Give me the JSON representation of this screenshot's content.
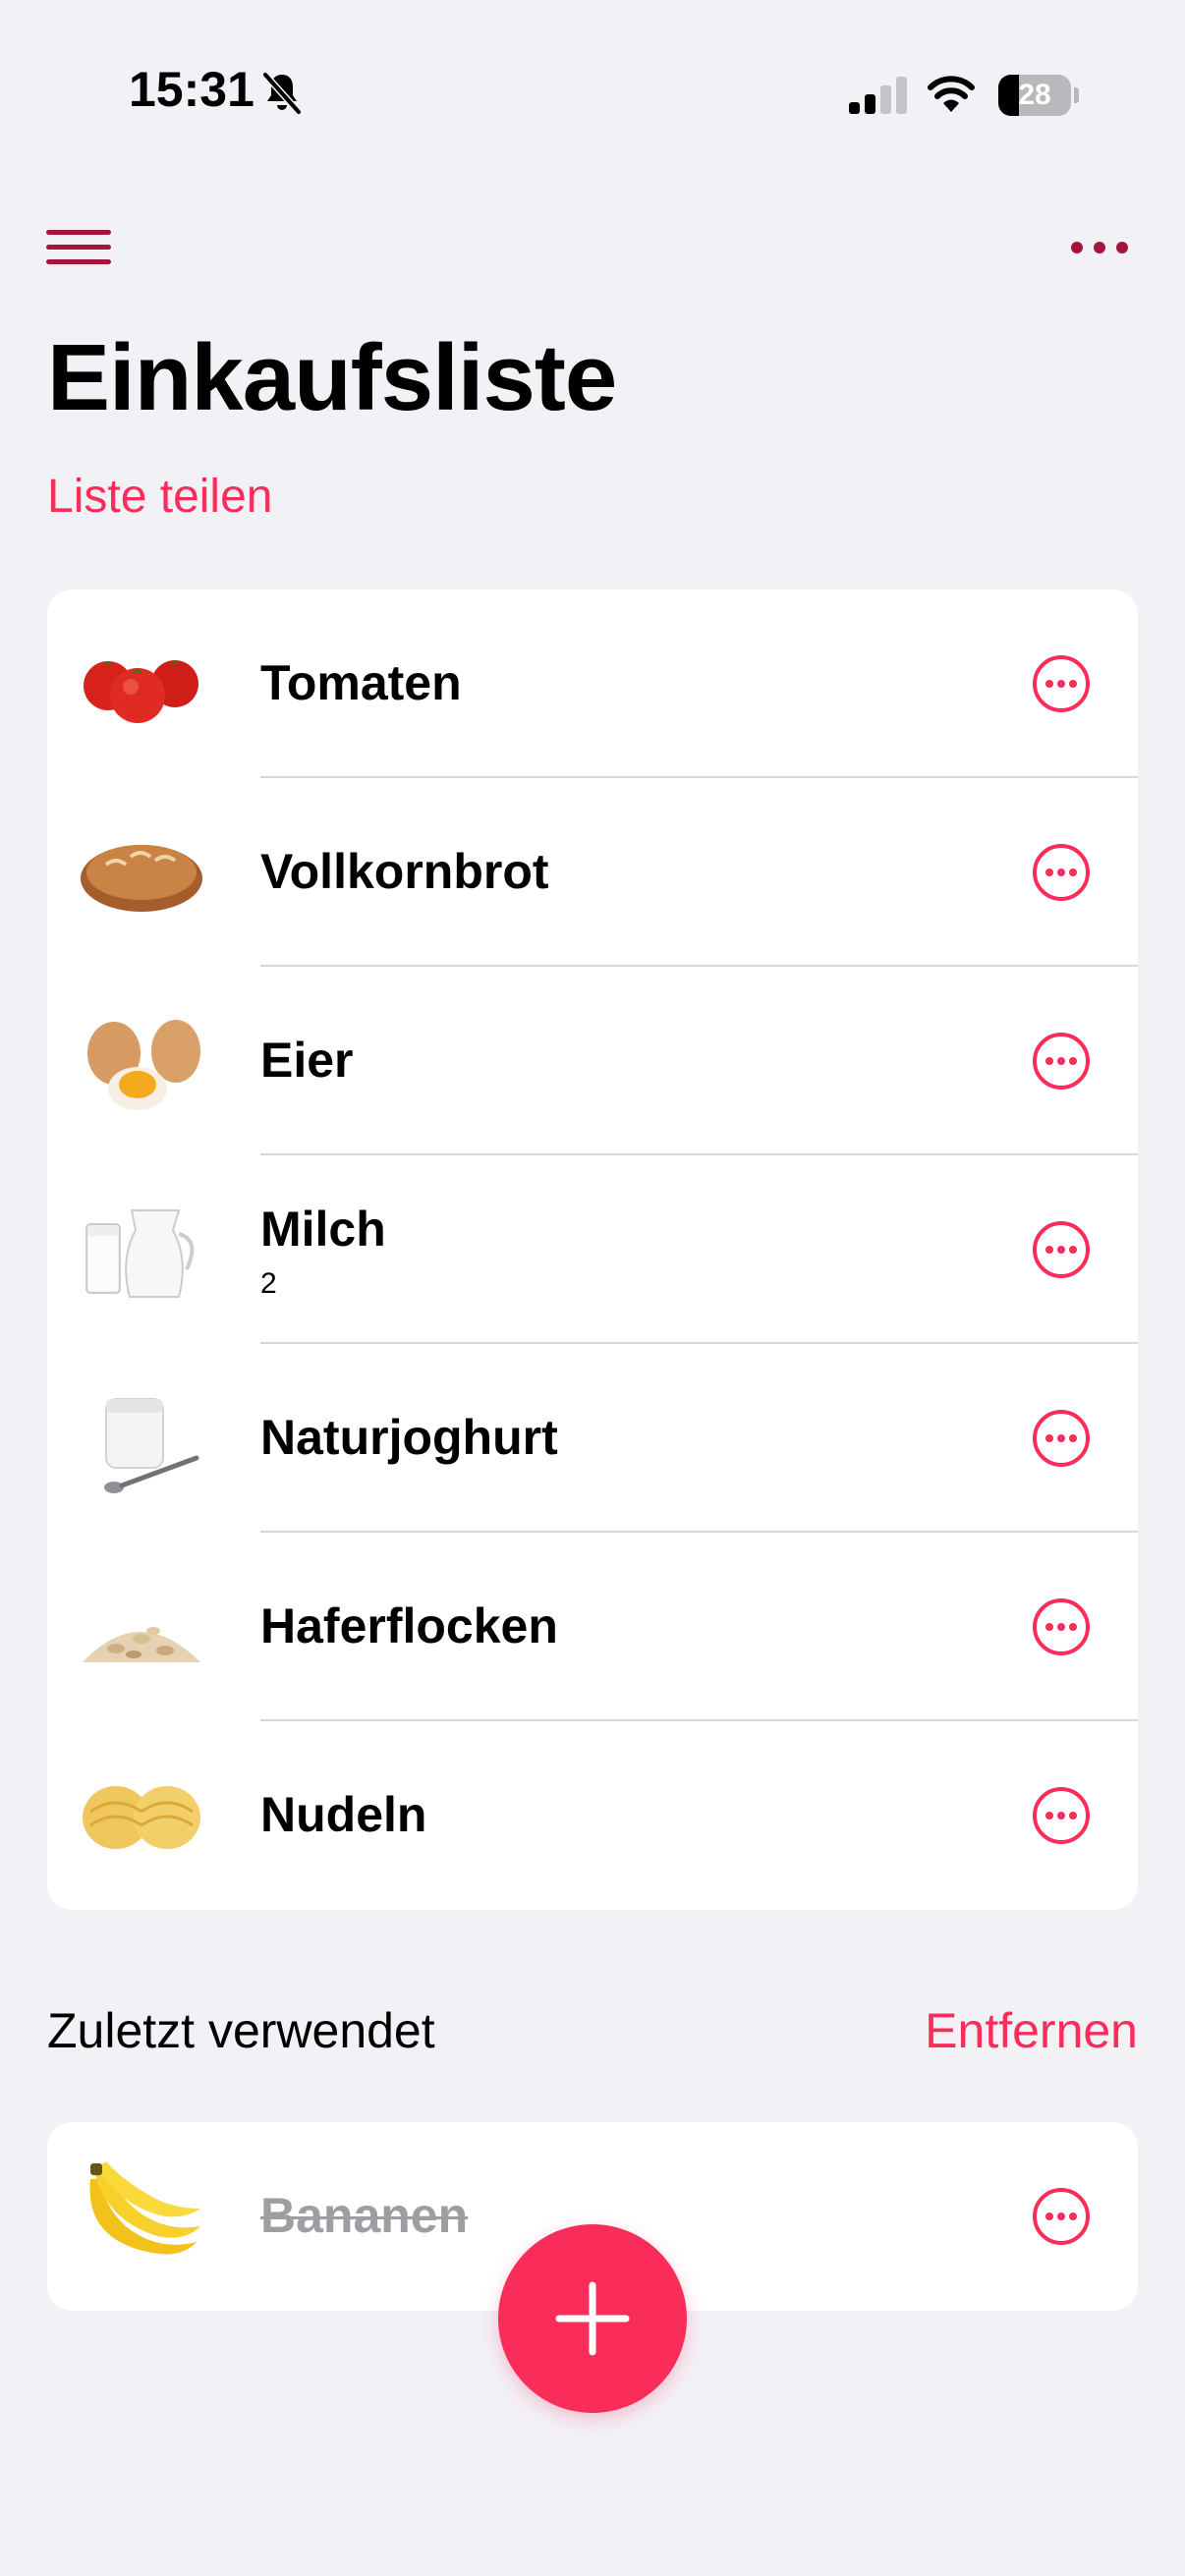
{
  "status_bar": {
    "time": "15:31",
    "battery": "28",
    "battery_level": 0.28,
    "icons": [
      "bell-slash-icon",
      "cellular-signal-icon",
      "wifi-icon",
      "battery-icon"
    ]
  },
  "nav": {
    "left_icon": "hamburger-menu-icon",
    "right_icon": "ellipsis-icon"
  },
  "header": {
    "title": "Einkaufsliste",
    "share_label": "Liste teilen"
  },
  "list": {
    "items": [
      {
        "name": "Tomaten",
        "quantity": "",
        "image": "tomatoes-image"
      },
      {
        "name": "Vollkornbrot",
        "quantity": "",
        "image": "bread-image"
      },
      {
        "name": "Eier",
        "quantity": "",
        "image": "eggs-image"
      },
      {
        "name": "Milch",
        "quantity": "2",
        "image": "milk-image"
      },
      {
        "name": "Naturjoghurt",
        "quantity": "",
        "image": "yogurt-image"
      },
      {
        "name": "Haferflocken",
        "quantity": "",
        "image": "oats-image"
      },
      {
        "name": "Nudeln",
        "quantity": "",
        "image": "pasta-image"
      }
    ]
  },
  "recent": {
    "title": "Zuletzt verwendet",
    "remove_label": "Entfernen",
    "items": [
      {
        "name": "Bananen",
        "image": "bananas-image",
        "done": true
      }
    ]
  },
  "fab": {
    "icon": "plus-icon"
  },
  "colors": {
    "accent": "#fa2d5a",
    "nav_icon": "#a3163a",
    "background": "#f2f1f6"
  }
}
